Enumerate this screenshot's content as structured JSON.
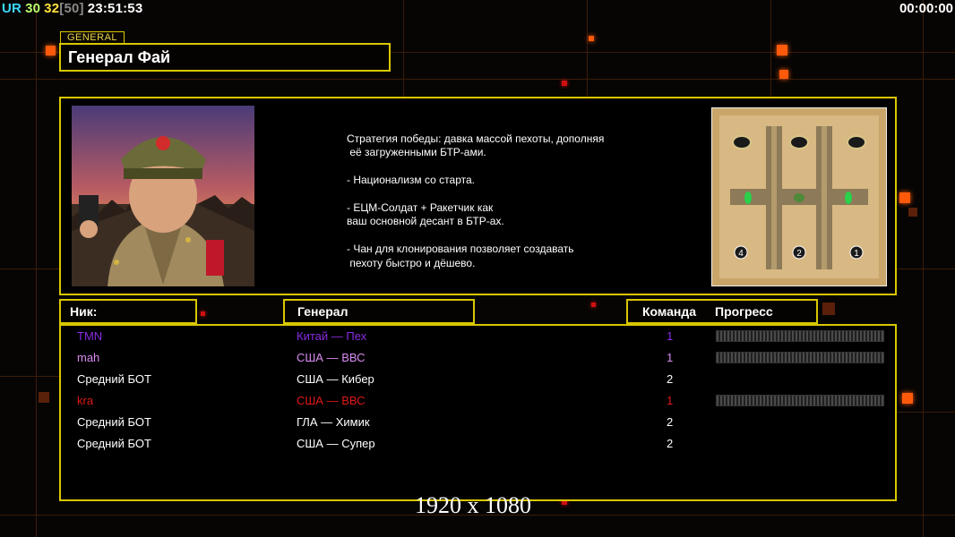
{
  "hud": {
    "ur_label": "UR",
    "value_a": "30",
    "value_b": "32",
    "value_c": "[50]",
    "clock": "23:51:53",
    "timer": "00:00:00"
  },
  "general": {
    "tag": "GENERAL",
    "name": "Генерал Фай",
    "description": "Стратегия победы: давка массой пехоты, дополняя\n её загруженными БТР-ами.\n\n- Национализм со старта.\n\n- ЕЦМ-Солдат + Ракетчик как\nваш основной десант в БТР-ах.\n\n- Чан для клонирования позволяет создавать\n пехоту быстро и дёшево."
  },
  "minimap": {
    "start_positions": [
      "4",
      "2",
      "1"
    ]
  },
  "columns": {
    "nick": "Ник:",
    "general": "Генерал",
    "team": "Команда",
    "progress": "Прогресс"
  },
  "players": [
    {
      "nick": "TMN",
      "general": "Китай — Пех",
      "team": "1",
      "color": "#8a2be2",
      "progress": 0
    },
    {
      "nick": "mah",
      "general": "США — ВВС",
      "team": "1",
      "color": "#d98cf0",
      "progress": 0
    },
    {
      "nick": "Средний БОТ",
      "general": "США — Кибер",
      "team": "2",
      "color": "#ffffff"
    },
    {
      "nick": "kra",
      "general": "США — ВВС",
      "team": "1",
      "color": "#e01818",
      "progress": 0
    },
    {
      "nick": "Средний БОТ",
      "general": "ГЛА — Химик",
      "team": "2",
      "color": "#ffffff"
    },
    {
      "nick": "Средний БОТ",
      "general": "США — Супер",
      "team": "2",
      "color": "#ffffff"
    }
  ],
  "resolution": "1920 x 1080"
}
